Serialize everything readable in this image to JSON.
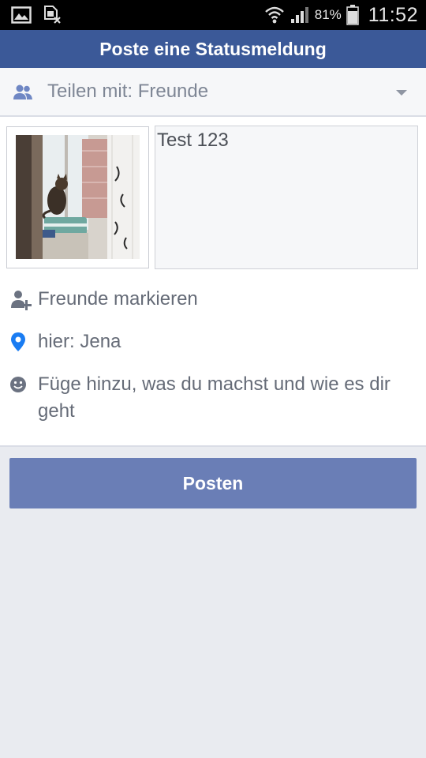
{
  "status_bar": {
    "battery_percent": "81%",
    "time": "11:52",
    "icons": [
      "image-icon",
      "sim-blocked-icon",
      "wifi-icon",
      "signal-icon",
      "battery-icon"
    ]
  },
  "header": {
    "title": "Poste eine Statusmeldung"
  },
  "audience": {
    "label": "Teilen mit: Freunde",
    "icon": "friends-icon"
  },
  "compose": {
    "text_value": "Test 123",
    "photo": "cat-window-photo"
  },
  "options": [
    {
      "label": "Freunde markieren",
      "icon": "tag-friend-icon"
    },
    {
      "label": "hier: Jena",
      "icon": "location-pin-icon"
    },
    {
      "label": "Füge hinzu, was du machst und wie es dir geht",
      "icon": "smiley-icon"
    }
  ],
  "post_button": {
    "label": "Posten"
  },
  "colors": {
    "brand": "#3b5998",
    "button": "#6a7eb6",
    "background": "#e9ebf0"
  }
}
